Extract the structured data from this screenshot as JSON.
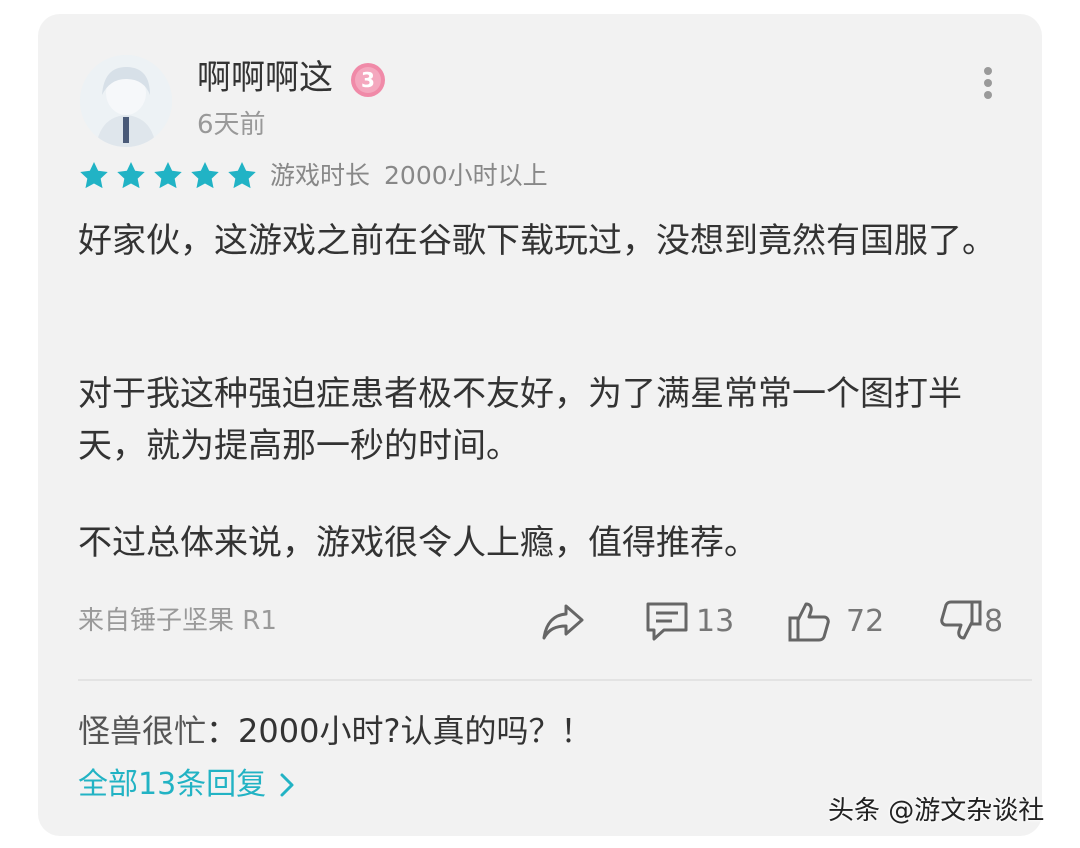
{
  "comment": {
    "username": "啊啊啊这",
    "badge_icon": "level-badge-icon",
    "time": "6天前",
    "rating": 5,
    "rating_max": 5,
    "playtime_label": "游戏时长",
    "playtime_value": "2000小时以上",
    "paragraphs": [
      "好家伙，这游戏之前在谷歌下载玩过，没想到竟然有国服了。",
      "对于我这种强迫症患者极不友好，为了满星常常一个图打半天，就为提高那一秒的时间。",
      "不过总体来说，游戏很令人上瘾，值得推荐。"
    ],
    "source": "来自锤子坚果 R1",
    "actions": {
      "comments": "13",
      "likes": "72",
      "dislikes": "8"
    }
  },
  "reply": {
    "author": "怪兽很忙",
    "separator": "：",
    "text": "2000小时?认真的吗？！"
  },
  "all_replies_link": "全部13条回复",
  "watermark": "头条 @游文杂谈社",
  "colors": {
    "card_bg": "#f2f2f2",
    "star": "#21b3c5",
    "link": "#22b3c4",
    "badge": "#f08aa8"
  }
}
